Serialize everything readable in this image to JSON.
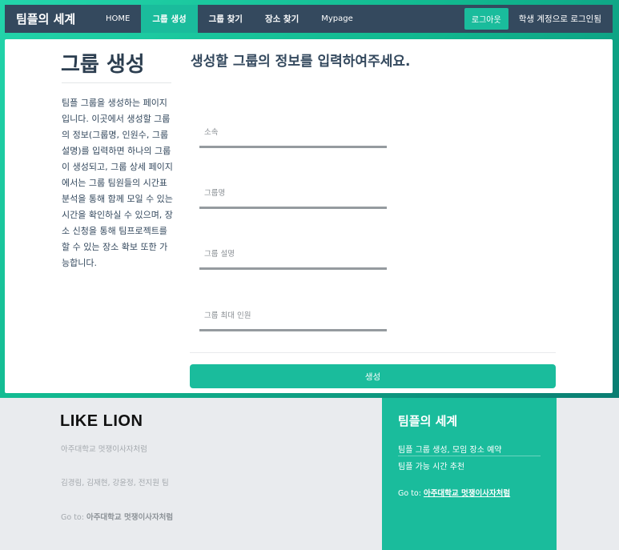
{
  "nav": {
    "brand": "팀플의 세계",
    "items": [
      {
        "label": "HOME"
      },
      {
        "label": "그룹 생성"
      },
      {
        "label": "그룹 찾기"
      },
      {
        "label": "장소 찾기"
      },
      {
        "label": "Mypage"
      }
    ],
    "logout_label": "로그아웃",
    "login_status": "학생 계정으로 로그인됨"
  },
  "page": {
    "title": "그룹 생성",
    "description": "팀플 그룹을 생성하는 페이지입니다. 이곳에서 생성할 그룹의 정보(그룹명, 인원수, 그룹설명)를 입력하면 하나의 그룹이 생성되고, 그룹 상세 페이지에서는 그룹 팀원들의 시간표 분석을 통해 함께 모일 수 있는 시간을 확인하실 수 있으며, 장소 신청을 통해 팀프로젝트를 할 수 있는 장소 확보 또한 가능합니다."
  },
  "form": {
    "title": "생성할 그룹의 정보를 입력하여주세요.",
    "fields": {
      "affiliation": {
        "placeholder": "소속",
        "value": ""
      },
      "group_name": {
        "placeholder": "그룹명",
        "value": ""
      },
      "group_description": {
        "placeholder": "그룹 설명",
        "value": ""
      },
      "max_members": {
        "placeholder": "그룹 최대 인원",
        "value": ""
      }
    },
    "submit_label": "생성"
  },
  "footer": {
    "logo": "LIKE LION",
    "org": "아주대학교 멋쟁이사자처럼",
    "team": "김경림, 김재현, 강윤정, 전지원 팀",
    "goto_prefix": "Go to: ",
    "goto_link": "아주대학교 멋쟁이사자처럼",
    "right": {
      "title": "팀플의 세계",
      "link1": "팀플 그룹 생성, 모임 장소 예약",
      "link2": "팀플 가능 시간 추천",
      "goto_prefix": "Go to: ",
      "goto_link": "아주대학교 멋쟁이사자처럼"
    }
  },
  "colors": {
    "accent": "#1abc9c",
    "navbar": "#34495e",
    "heading": "#2c3e50"
  }
}
